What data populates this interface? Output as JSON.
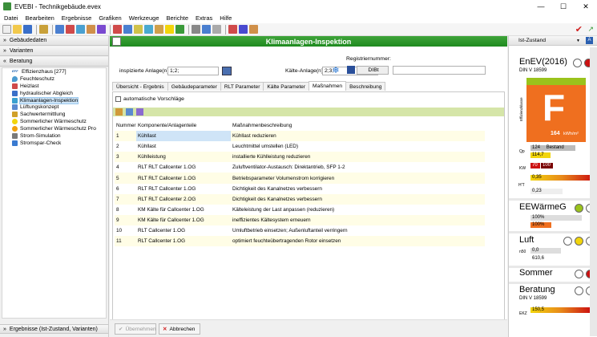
{
  "window": {
    "title": "EVEBI - Technikgebäude.evex",
    "min": "—",
    "max": "☐",
    "close": "✕"
  },
  "menu": [
    "Datei",
    "Bearbeiten",
    "Ergebnisse",
    "Grafiken",
    "Werkzeuge",
    "Berichte",
    "Extras",
    "Hilfe"
  ],
  "left": {
    "sections": {
      "gebaeudedaten": "Gebäudedaten",
      "varianten": "Varianten",
      "beratung": "Beratung",
      "ergebnisse": "Ergebnisse (Ist-Zustand, Varianten)"
    },
    "tree": [
      "Effizienzhaus [277]",
      "Feuchteschutz",
      "Heizlast",
      "hydraulischer Abgleich",
      "Klimaanlagen-Inspektion",
      "Lüftungskonzept",
      "Sachwertermittlung",
      "Sommerlicher Wärmeschutz",
      "Sommerlicher Wärmeschutz Pro",
      "Strom-Simulation",
      "Stromspar-Check"
    ],
    "effizienz_badge": "EFF"
  },
  "center": {
    "title": "Klimaanlagen-Inspektion",
    "anlagen_label": "inspizierte Anlage(n)",
    "anlagen_value": "1;2;",
    "kaelte_label": "Kälte-Anlage(n)",
    "kaelte_value": "2;3;",
    "registriernummer_label": "Registriernummer:",
    "dibt_label": "DIBt",
    "registriernummer_value": "",
    "tabs": [
      "Übersicht - Ergebnis",
      "Gebäudeparameter",
      "RLT Parameter",
      "Kälte Parameter",
      "Maßnahmen",
      "Beschreibung"
    ],
    "auto_label": "automatische Vorschläge",
    "columns": [
      "Nummer",
      "Komponente/Anlagenteile",
      "Maßnahmenbeschreibung"
    ],
    "rows": [
      [
        "1",
        "Kühllast",
        "Kühllast reduzieren"
      ],
      [
        "2",
        "Kühllast",
        "Leuchtmittel umstellen (LED)"
      ],
      [
        "3",
        "Kühlleistung",
        "installierte Kühlleistung reduzieren"
      ],
      [
        "4",
        "RLT RLT Callcenter 1.OG",
        "Zuluftventilator-Austausch: Direktantrieb, SFP 1-2"
      ],
      [
        "5",
        "RLT RLT Callcenter 1.OG",
        "Betriebsparameter Volumenstrom korrigieren"
      ],
      [
        "6",
        "RLT RLT Callcenter 1.OG",
        "Dichtigkeit des Kanalnetzes verbessern"
      ],
      [
        "7",
        "RLT RLT Callcenter 2.OG",
        "Dichtigkeit des Kanalnetzes verbessern"
      ],
      [
        "8",
        "KM Kälte für Callcenter 1.OG",
        "Kälteleistung der Last anpassen (reduzieren)"
      ],
      [
        "9",
        "KM Kälte für Callcenter 1.OG",
        "ineffizientes Kältesystem erneuern"
      ],
      [
        "10",
        "RLT Callcenter 1.OG",
        "Umluftbetrieb einsetzen; Außenluftanteil verringern"
      ],
      [
        "11",
        "RLT Callcenter 1.OG",
        "optimiert feuchteübertragenden Rotor einsetzen"
      ]
    ],
    "btn_uebernehmen": "Übernehmen",
    "btn_abbrechen": "Abbrechen"
  },
  "right": {
    "status": "Ist-Zustand",
    "a_badge": "A",
    "enev_title": "EnEV(2016)",
    "enev_sub": "DIN V 18599",
    "enev_side": "Effizienzklasse",
    "enev_class": "F",
    "enev_value": "164",
    "enev_unit": "kWh/m²",
    "qp_label": "Qp",
    "qp_val1": "124",
    "qp_val1b": "Bestand",
    "qp_val2": "114,7",
    "kw_label": "KW",
    "kw_val1": "70",
    "kw_val2": "100",
    "ht_label": "H'T",
    "ht_val1": "0,35",
    "ht_val2": "0,23",
    "eew_title": "EEWärmeG",
    "eew_val1": "100%",
    "eew_val2": "100%",
    "luft_title": "Luft",
    "luft_side": "n50",
    "luft_val1": "0,0",
    "luft_val2": "610,6",
    "sommer_title": "Sommer",
    "beratung_title": "Beratung",
    "beratung_sub": "DIN V 18599",
    "ekz_label": "EKZ",
    "ekz_val": "150,5"
  },
  "colors": {
    "green": "#2e9a2b",
    "orange": "#ef6f1f",
    "red": "#cc1111",
    "yellow": "#f2d50c",
    "olive": "#9ac31c"
  }
}
